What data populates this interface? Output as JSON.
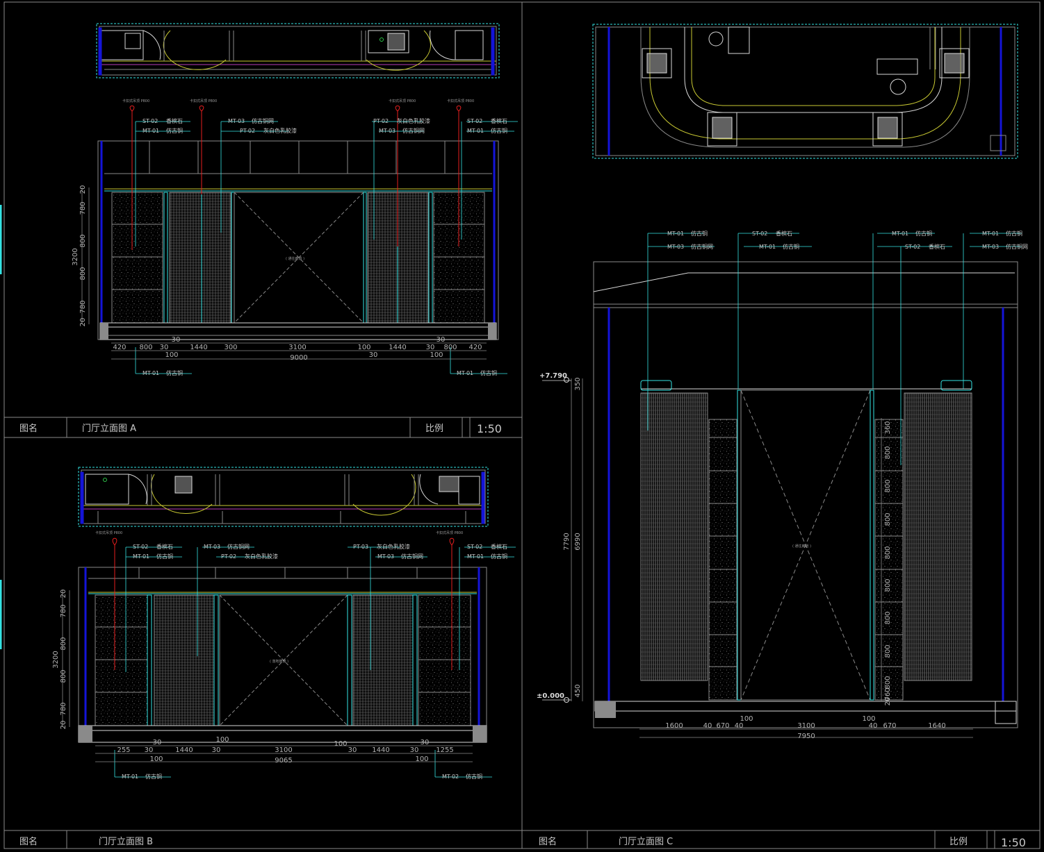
{
  "colors": {
    "cyan": "#35e3e3",
    "gray": "#8a8a8a",
    "white": "#d8d8d8",
    "blue": "#1414d8",
    "red": "#e61e1e",
    "magenta": "#b83cb8",
    "yellow": "#c8c832",
    "green": "#2ec84a"
  },
  "title_block": {
    "name_label": "图名",
    "scale_label": "比例"
  },
  "sheets": {
    "a": {
      "title": "门厅立面图 A",
      "scale": "1:50"
    },
    "b": {
      "title": "门厅立面图 B"
    },
    "c": {
      "title": "门厅立面图 C",
      "scale": "1:50"
    }
  },
  "elevation_a": {
    "tags_top": [
      {
        "code": "ST-02",
        "text": "香槟石"
      },
      {
        "code": "MT-01",
        "text": "仿古铜"
      },
      {
        "code": "MT-03",
        "text": "仿古铜网"
      },
      {
        "code": "PT-02",
        "text": "灰白色乳胶漆"
      },
      {
        "code": "PT-02",
        "text": "灰白色乳胶漆"
      },
      {
        "code": "MT-03",
        "text": "仿古铜网"
      },
      {
        "code": "ST-02",
        "text": "香槟石"
      },
      {
        "code": "MT-01",
        "text": "仿古铜"
      }
    ],
    "tags_bottom": [
      {
        "code": "MT-01",
        "text": "仿古铜"
      },
      {
        "code": "MT-01",
        "text": "仿古铜"
      }
    ],
    "dims_bottom": [
      "420",
      "800",
      "30",
      "1440",
      "300",
      "3100",
      "100",
      "1440",
      "30",
      "800",
      "420"
    ],
    "dims_bottom_2": [
      "100",
      "30",
      "100"
    ],
    "dims_small": [
      "30",
      "30"
    ],
    "total": "9000",
    "dims_left": [
      "20",
      "780",
      "800",
      "800",
      "780",
      "20"
    ],
    "total_left": "3200"
  },
  "elevation_b": {
    "tags_top": [
      {
        "code": "ST-02",
        "text": "香槟石"
      },
      {
        "code": "MT-01",
        "text": "仿古铜"
      },
      {
        "code": "MT-03",
        "text": "仿古铜网"
      },
      {
        "code": "PT-02",
        "text": "灰白色乳胶漆"
      },
      {
        "code": "PT-03",
        "text": "灰白色乳胶漆"
      },
      {
        "code": "MT-03",
        "text": "仿古铜网"
      },
      {
        "code": "ST-02",
        "text": "香槟石"
      },
      {
        "code": "MT-01",
        "text": "仿古铜"
      }
    ],
    "tags_bottom": [
      {
        "code": "MT-01",
        "text": "仿古铜"
      },
      {
        "code": "MT-02",
        "text": "仿古铜"
      }
    ],
    "dims_bottom": [
      "255",
      "30",
      "1440",
      "30",
      "3100",
      "30",
      "1440",
      "30",
      "1255"
    ],
    "dims_bottom_2": [
      "100",
      "100"
    ],
    "dims_small": [
      "30",
      "100",
      "100",
      "30"
    ],
    "total": "9065",
    "dims_left": [
      "20",
      "780",
      "800",
      "800",
      "780",
      "20"
    ],
    "total_left": "3200"
  },
  "elevation_c": {
    "tags_top": [
      {
        "code": "MT-01",
        "text": "仿古铜"
      },
      {
        "code": "MT-03",
        "text": "仿古铜网"
      },
      {
        "code": "ST-02",
        "text": "香槟石"
      },
      {
        "code": "MT-01",
        "text": "仿古铜"
      },
      {
        "code": "MT-01",
        "text": "仿古铜"
      },
      {
        "code": "ST-02",
        "text": "香槟石"
      },
      {
        "code": "MT-01",
        "text": "仿古铜"
      },
      {
        "code": "MT-03",
        "text": "仿古铜网"
      }
    ],
    "elev_top": "+7.790",
    "elev_base": "±0.000",
    "dims_left": [
      "350",
      "6990",
      "450"
    ],
    "total_left": "7790",
    "dims_right": [
      "360",
      "800",
      "800",
      "800",
      "800",
      "800",
      "800",
      "800",
      "800",
      "760",
      "20"
    ],
    "dims_bottom": [
      "1600",
      "40",
      "670",
      "40",
      "3100",
      "40",
      "670",
      "1640"
    ],
    "dims_small": [
      "100",
      "100"
    ],
    "total": "7950"
  }
}
